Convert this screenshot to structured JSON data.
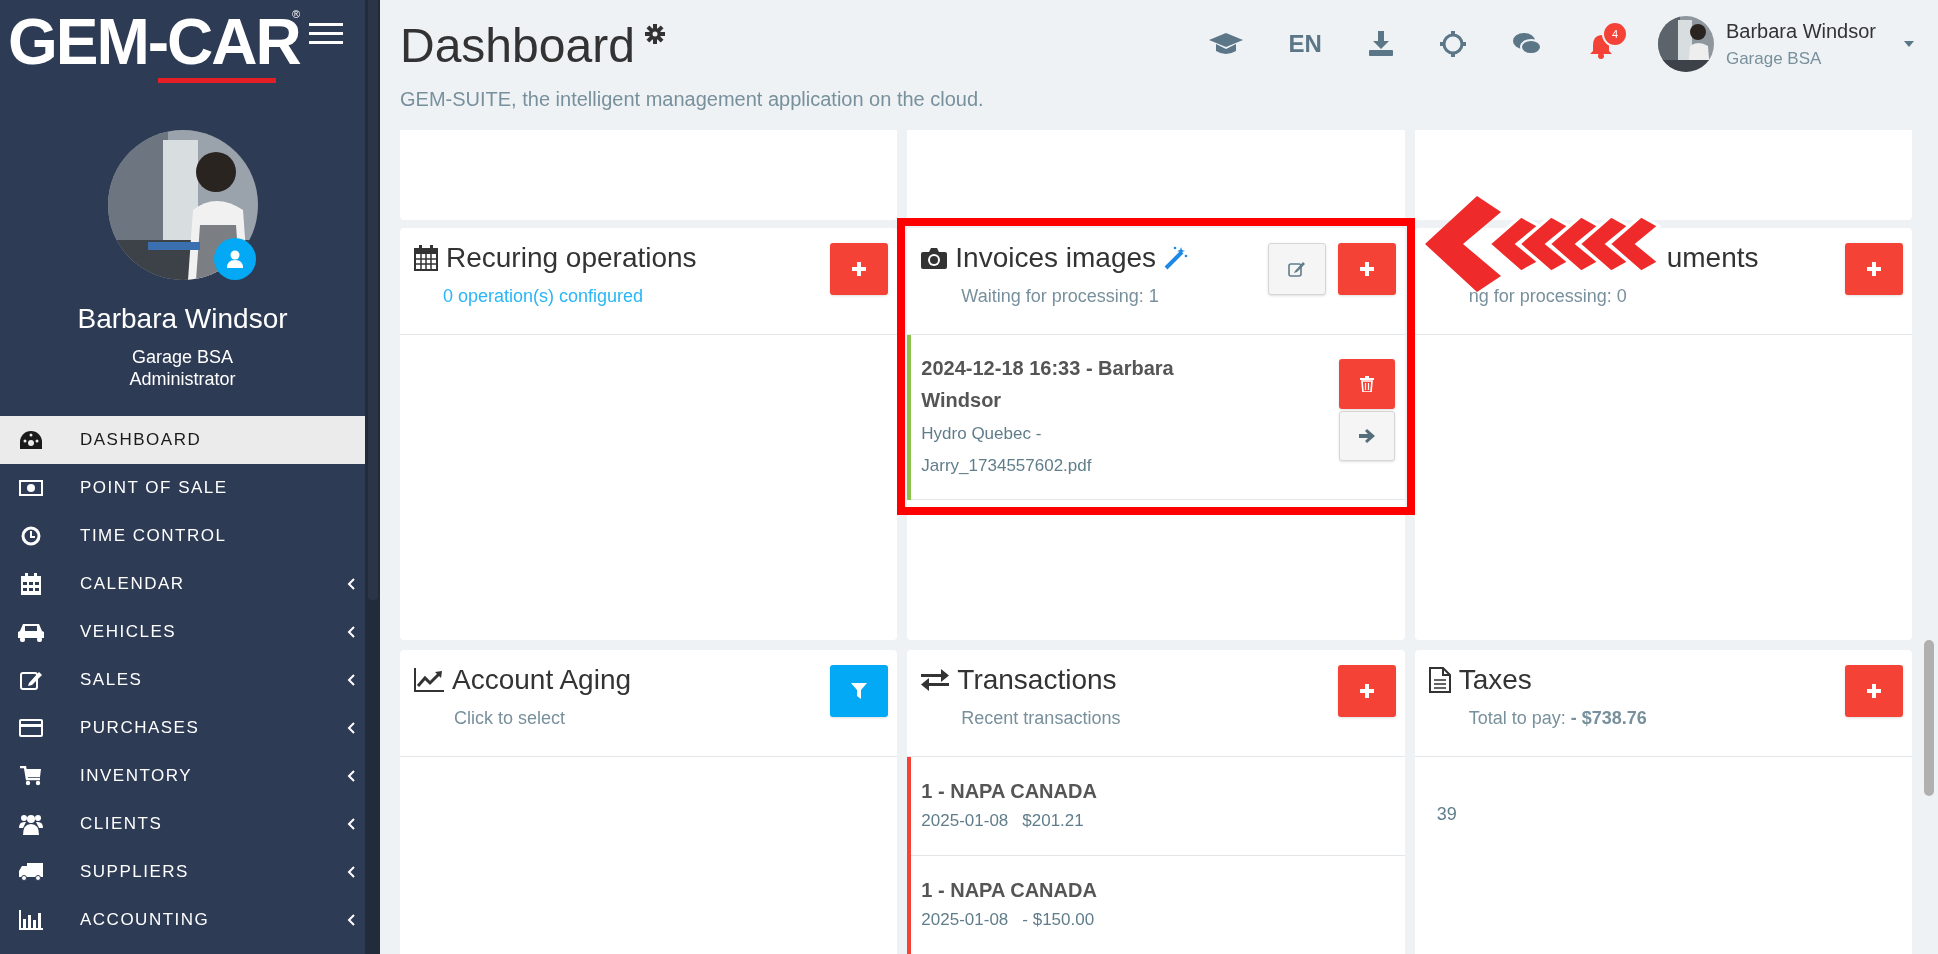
{
  "sidebar": {
    "logo": "GEM-CAR",
    "logo_mark": "®",
    "user": {
      "name": "Barbara Windsor",
      "company": "Garage BSA",
      "role": "Administrator"
    },
    "items": [
      {
        "label": "DASHBOARD",
        "selected": true,
        "expandable": false
      },
      {
        "label": "POINT OF SALE",
        "selected": false,
        "expandable": false
      },
      {
        "label": "TIME CONTROL",
        "selected": false,
        "expandable": false
      },
      {
        "label": "CALENDAR",
        "selected": false,
        "expandable": true
      },
      {
        "label": "VEHICLES",
        "selected": false,
        "expandable": true
      },
      {
        "label": "SALES",
        "selected": false,
        "expandable": true
      },
      {
        "label": "PURCHASES",
        "selected": false,
        "expandable": true
      },
      {
        "label": "INVENTORY",
        "selected": false,
        "expandable": true
      },
      {
        "label": "CLIENTS",
        "selected": false,
        "expandable": true
      },
      {
        "label": "SUPPLIERS",
        "selected": false,
        "expandable": true
      },
      {
        "label": "ACCOUNTING",
        "selected": false,
        "expandable": true
      }
    ]
  },
  "header": {
    "title": "Dashboard",
    "subtitle": "GEM-SUITE, the intelligent management application on the cloud.",
    "language": "EN",
    "notifications": "4",
    "user": {
      "name": "Barbara Windsor",
      "company": "Garage BSA"
    }
  },
  "cards": [
    {
      "kind": "recurring",
      "title": "Recuring operations",
      "subtitle": {
        "text": "0 operation(s) configured",
        "link": true
      },
      "buttons": [
        {
          "kind": "add"
        }
      ]
    },
    {
      "kind": "invoices",
      "title": "Invoices images",
      "subtitle": {
        "text": "Waiting for processing: 1",
        "link": false
      },
      "buttons": [
        {
          "kind": "edit"
        },
        {
          "kind": "add"
        }
      ],
      "items": [
        {
          "title": "2024-12-18 16:33 - Barbara Windsor",
          "detail": "Hydro Quebec - Jarry_1734557602.pdf",
          "color": "#8bc34a"
        }
      ],
      "highlighted": true
    },
    {
      "kind": "documents",
      "title_parts": [
        "uments"
      ],
      "subtitle": {
        "text": "ng for processing: 0",
        "link": false
      },
      "buttons": [
        {
          "kind": "add"
        }
      ]
    },
    {
      "kind": "aging",
      "title": "Account Aging",
      "subtitle": {
        "text": "Click to select",
        "link": false
      },
      "buttons": [
        {
          "kind": "filter"
        }
      ]
    },
    {
      "kind": "transactions",
      "title": "Transactions",
      "subtitle": {
        "text": "Recent transactions",
        "link": false
      },
      "buttons": [
        {
          "kind": "add"
        }
      ],
      "items": [
        {
          "title": "1 - NAPA CANADA",
          "date": "2025-01-08",
          "amount": "$201.21",
          "color": "#f44336"
        },
        {
          "title": "1 - NAPA CANADA",
          "date": "2025-01-08",
          "amount": "- $150.00",
          "color": "#f44336"
        }
      ]
    },
    {
      "kind": "taxes",
      "title": "Taxes",
      "subtitle": {
        "text": "Total to pay: **- $738.76**",
        "link": false
      },
      "buttons": [
        {
          "kind": "add"
        }
      ],
      "body": "39"
    }
  ]
}
